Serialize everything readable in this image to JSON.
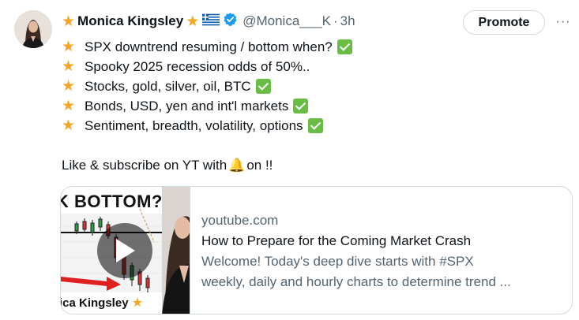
{
  "author": {
    "name": "Monica Kingsley",
    "handle": "@Monica___K",
    "separator": "·",
    "time": "3h"
  },
  "actions": {
    "promote_label": "Promote",
    "more_label": "···"
  },
  "tweet": {
    "lines": [
      "SPX downtrend resuming / bottom when?",
      "Spooky 2025 recession odds of 50%..",
      "Stocks, gold, silver, oil, BTC",
      "Bonds, USD, yen and int'l markets",
      "Sentiment, breadth, volatility, options"
    ],
    "cta_before": "Like & subscribe on YT with",
    "cta_after": "on !!"
  },
  "card": {
    "thumb_title": "K BOTTOM?",
    "thumb_name": "ica Kingsley",
    "domain": "youtube.com",
    "title": "How to Prepare for the Coming Market Crash",
    "description_line1": "Welcome! Today's deep dive starts with #SPX",
    "description_line2": "weekly, daily and hourly charts to determine trend ..."
  },
  "icons": {
    "star": "star-icon",
    "flag": "greek-flag-icon",
    "verified": "verified-badge-icon",
    "check": "check-mark-icon",
    "bell": "bell-icon",
    "play": "play-icon"
  },
  "colors": {
    "star": "#f5a623",
    "verified": "#1d9bf0",
    "check": "#6abd44",
    "secondary_text": "#536471",
    "border": "#cfd9de"
  }
}
